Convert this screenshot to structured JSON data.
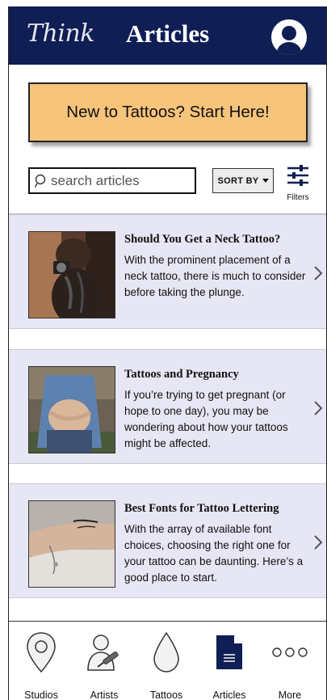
{
  "header": {
    "logo": "Think",
    "title": "Articles",
    "avatar_icon": "user-avatar-icon"
  },
  "cta": {
    "label": "New to Tattoos? Start Here!"
  },
  "search": {
    "placeholder": "search articles",
    "value": ""
  },
  "sort": {
    "label": "SORT BY"
  },
  "filters": {
    "label": "Filters"
  },
  "articles": [
    {
      "title": "Should You Get a Neck Tattoo?",
      "text": "With the prominent placement of a neck tattoo, there is much to consider before taking the plunge."
    },
    {
      "title": "Tattoos and Pregnancy",
      "text": "If you’re trying to get pregnant (or hope to one day), you may be wondering about how your tattoos might be affected."
    },
    {
      "title": "Best Fonts for Tattoo Lettering",
      "text": "With the array of available font choices, choosing the right one for your tattoo can be daunting. Here’s a good place to start."
    }
  ],
  "nav": [
    {
      "label": "Studios",
      "icon": "map-pin-icon"
    },
    {
      "label": "Artists",
      "icon": "artist-icon"
    },
    {
      "label": "Tattoos",
      "icon": "ink-drop-icon"
    },
    {
      "label": "Articles",
      "icon": "document-icon"
    },
    {
      "label": "More",
      "icon": "more-dots-icon"
    }
  ],
  "colors": {
    "header_bg": "#0f1e54",
    "cta_bg": "#f7c47c",
    "card_bg": "#e6e6f4"
  }
}
